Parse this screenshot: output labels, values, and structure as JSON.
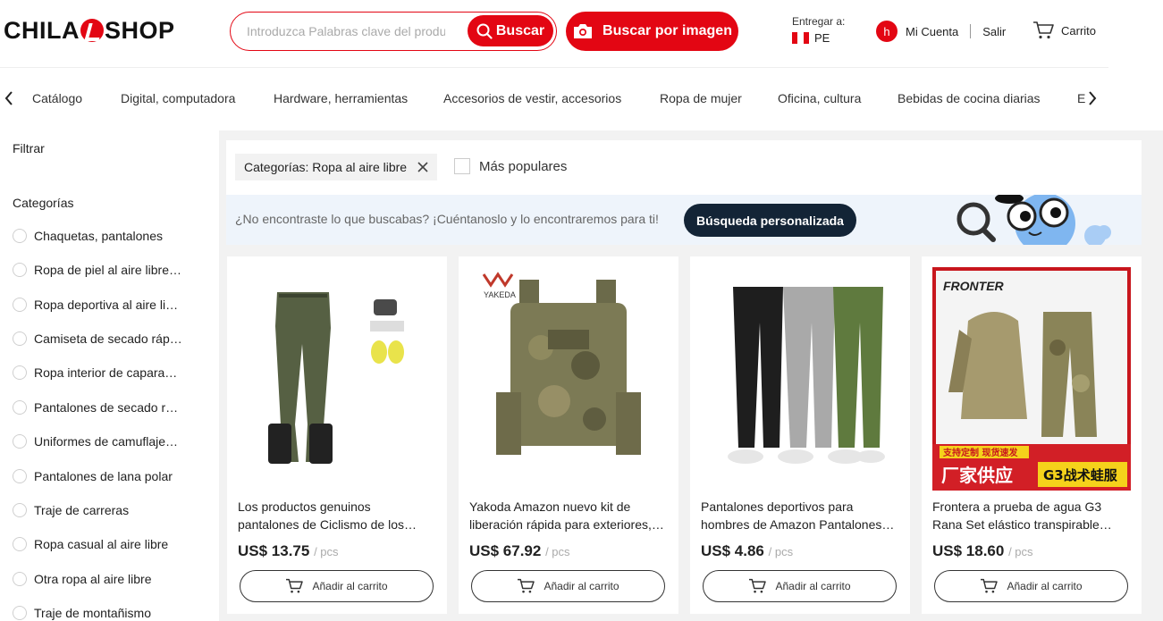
{
  "header": {
    "logo_left": "CHILA",
    "logo_right": "SHOP",
    "search_placeholder": "Introduzca Palabras clave del producto",
    "search_button": "Buscar",
    "image_search_button": "Buscar por imagen",
    "deliver_label": "Entregar a:",
    "country": "PE",
    "avatar_letter": "h",
    "account": "Mi Cuenta",
    "logout": "Salir",
    "cart": "Carrito"
  },
  "nav": {
    "items": [
      "Catálogo",
      "Digital, computadora",
      "Hardware, herramientas",
      "Accesorios de vestir, accesorios",
      "Ropa de mujer",
      "Oficina, cultura",
      "Bebidas de cocina diarias",
      "E"
    ]
  },
  "sidebar": {
    "filter_title": "Filtrar",
    "categories_title": "Categorías",
    "categories": [
      "Chaquetas, pantalones",
      "Ropa de piel al aire libre…",
      "Ropa deportiva al aire li…",
      "Camiseta de secado ráp…",
      "Ropa interior de capara…",
      "Pantalones de secado r…",
      "Uniformes de camuflaje…",
      "Pantalones de lana polar",
      "Traje de carreras",
      "Ropa casual al aire libre",
      "Otra ropa al aire libre",
      "Traje de montañismo"
    ]
  },
  "filters": {
    "active_chip": "Categorías: Ropa al aire libre",
    "popular_label": "Más populares"
  },
  "banner": {
    "text": "¿No encontraste lo que buscabas? ¡Cuéntanoslo y lo encontraremos para ti!",
    "button": "Búsqueda personalizada"
  },
  "products": [
    {
      "title": "Los productos genuinos pantalones de Ciclismo de los…",
      "price": "US$ 13.75",
      "unit": "/ pcs",
      "button": "Añadir al carrito"
    },
    {
      "title": "Yakoda Amazon nuevo kit de liberación rápida para exteriores,…",
      "price": "US$ 67.92",
      "unit": "/ pcs",
      "button": "Añadir al carrito",
      "brand": "YAKEDA"
    },
    {
      "title": "Pantalones deportivos para hombres de Amazon Pantalones…",
      "price": "US$ 4.86",
      "unit": "/ pcs",
      "button": "Añadir al carrito"
    },
    {
      "title": "Frontera a prueba de agua G3 Rana Set elástico transpirable…",
      "price": "US$ 18.60",
      "unit": "/ pcs",
      "button": "Añadir al carrito",
      "brand": "FRONTER",
      "banner_cn_top": "支持定制 现货速发",
      "banner_cn_left": "厂家供应",
      "banner_cn_right": "G3战术蛙服"
    }
  ],
  "colors": {
    "accent": "#e30613",
    "dark_button": "#132436",
    "banner_bg": "#eef4fb",
    "page_gray": "#f2f2f2"
  }
}
